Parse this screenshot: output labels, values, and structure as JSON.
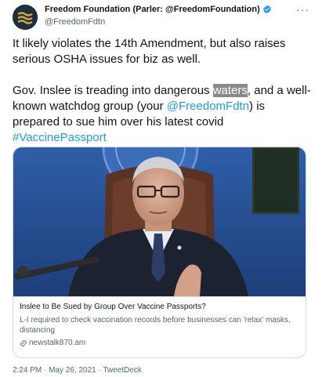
{
  "author": {
    "display_name": "Freedom Foundation (Parler: @FreedomFoundation)",
    "handle": "@FreedomFdtn",
    "verified_icon": "verified-badge-icon",
    "avatar_icon": "freedom-foundation-logo"
  },
  "menu": {
    "more_label": "···"
  },
  "tweet": {
    "para1": "It likely violates the 14th Amendment, but also raises serious OSHA issues for biz as well.",
    "para2_a": "Gov. Inslee is treading into dangerous ",
    "para2_highlight": "waters",
    "para2_b": ", and a well-known watchdog group (your ",
    "mention": "@FreedomFdtn",
    "para2_c": ") is prepared to sue him over his latest covid ",
    "hashtag": "#VaccinePassport"
  },
  "card": {
    "title": "Inslee to Be Sued by Group Over Vaccine Passports?",
    "description": "L-I required to check vaccination records before businesses can 'relax' masks, distancing",
    "domain": "newstalk870.am",
    "domain_icon": "link-icon"
  },
  "footer": {
    "timestamp": "2:24 PM · May 26, 2021 · TweetDeck"
  },
  "colors": {
    "link": "#1d9bf0",
    "secondary_text": "#536471",
    "border": "#cfd9de"
  }
}
